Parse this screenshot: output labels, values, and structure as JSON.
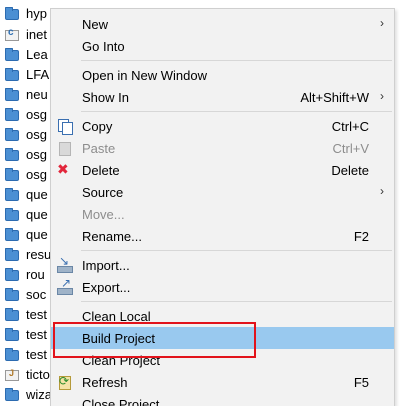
{
  "tree": {
    "items": [
      {
        "label": "hyp",
        "icon": "folder-icon"
      },
      {
        "label": "inet",
        "icon": "c-project-icon"
      },
      {
        "label": "Lea",
        "icon": "folder-icon"
      },
      {
        "label": "LFA",
        "icon": "folder-icon"
      },
      {
        "label": "neu",
        "icon": "folder-icon"
      },
      {
        "label": "osg",
        "icon": "folder-icon"
      },
      {
        "label": "osg",
        "icon": "folder-icon"
      },
      {
        "label": "osg",
        "icon": "folder-icon"
      },
      {
        "label": "osg",
        "icon": "folder-icon"
      },
      {
        "label": "que",
        "icon": "folder-icon"
      },
      {
        "label": "que",
        "icon": "folder-icon"
      },
      {
        "label": "que",
        "icon": "folder-icon"
      },
      {
        "label": "resu",
        "icon": "folder-icon"
      },
      {
        "label": "rou",
        "icon": "folder-icon"
      },
      {
        "label": "soc",
        "icon": "folder-icon"
      },
      {
        "label": "test",
        "icon": "folder-icon"
      },
      {
        "label": "test",
        "icon": "folder-icon"
      },
      {
        "label": "test",
        "icon": "folder-icon"
      },
      {
        "label": "ticto",
        "icon": "java-project-icon"
      },
      {
        "label": "wiza",
        "icon": "folder-icon"
      }
    ]
  },
  "menu": {
    "new_label": "New",
    "go_into_label": "Go Into",
    "open_new_window_label": "Open in New Window",
    "show_in_label": "Show In",
    "show_in_accel": "Alt+Shift+W",
    "copy_label": "Copy",
    "copy_accel": "Ctrl+C",
    "paste_label": "Paste",
    "paste_accel": "Ctrl+V",
    "delete_label": "Delete",
    "delete_accel": "Delete",
    "source_label": "Source",
    "move_label": "Move...",
    "rename_label": "Rename...",
    "rename_accel": "F2",
    "import_label": "Import...",
    "export_label": "Export...",
    "clean_local_label": "Clean Local",
    "build_project_label": "Build Project",
    "clean_project_label": "Clean Project",
    "refresh_label": "Refresh",
    "refresh_accel": "F5",
    "close_project_label": "Close Project",
    "submenu_arrow": "›"
  },
  "colors": {
    "highlight": "#99c9ef",
    "annotation": "#e2131b",
    "menu_bg": "#f2f2f2",
    "folder": "#4b8fd3"
  }
}
